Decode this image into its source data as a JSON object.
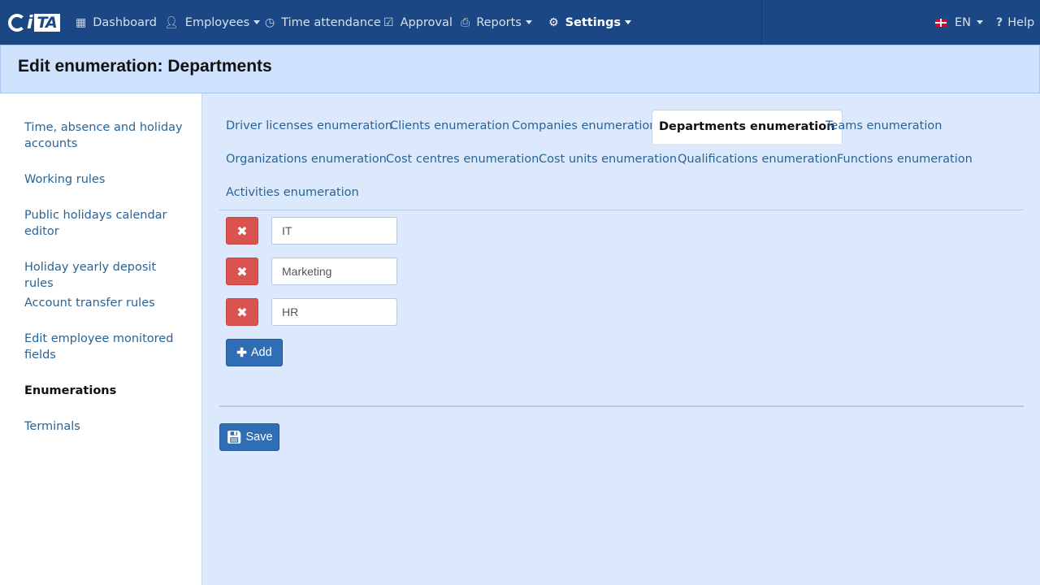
{
  "nav": {
    "logo": "iTA",
    "dashboard": "Dashboard",
    "employees": "Employees",
    "time_attendance": "Time attendance",
    "approval": "Approval",
    "reports": "Reports",
    "settings": "Settings",
    "language": "EN",
    "help": "Help"
  },
  "page": {
    "title": "Edit enumeration: Departments"
  },
  "sidebar": {
    "items": [
      {
        "label": "Time, absence and holiday accounts"
      },
      {
        "label": "Working rules"
      },
      {
        "label": "Public holidays calendar editor"
      },
      {
        "label": "Holiday yearly deposit rules"
      },
      {
        "label": "Account transfer rules"
      },
      {
        "label": "Edit employee monitored fields"
      },
      {
        "label": "Enumerations",
        "active": true
      },
      {
        "label": "Terminals"
      }
    ]
  },
  "tabs": [
    {
      "label": "Driver licenses enumeration"
    },
    {
      "label": "Clients enumeration"
    },
    {
      "label": "Companies enumeration"
    },
    {
      "label": "Departments enumeration",
      "active": true
    },
    {
      "label": "Teams enumeration"
    },
    {
      "label": "Organizations enumeration"
    },
    {
      "label": "Cost centres enumeration"
    },
    {
      "label": "Cost units enumeration"
    },
    {
      "label": "Qualifications enumeration"
    },
    {
      "label": "Functions enumeration"
    },
    {
      "label": "Activities enumeration"
    }
  ],
  "entries": [
    {
      "value": "IT"
    },
    {
      "value": "Marketing"
    },
    {
      "value": "HR"
    }
  ],
  "buttons": {
    "add": "Add",
    "save": "Save"
  },
  "colors": {
    "navbar": "#1b4784",
    "delete": "#d9534f",
    "primary": "#2f6db5",
    "link": "#2a6496"
  }
}
